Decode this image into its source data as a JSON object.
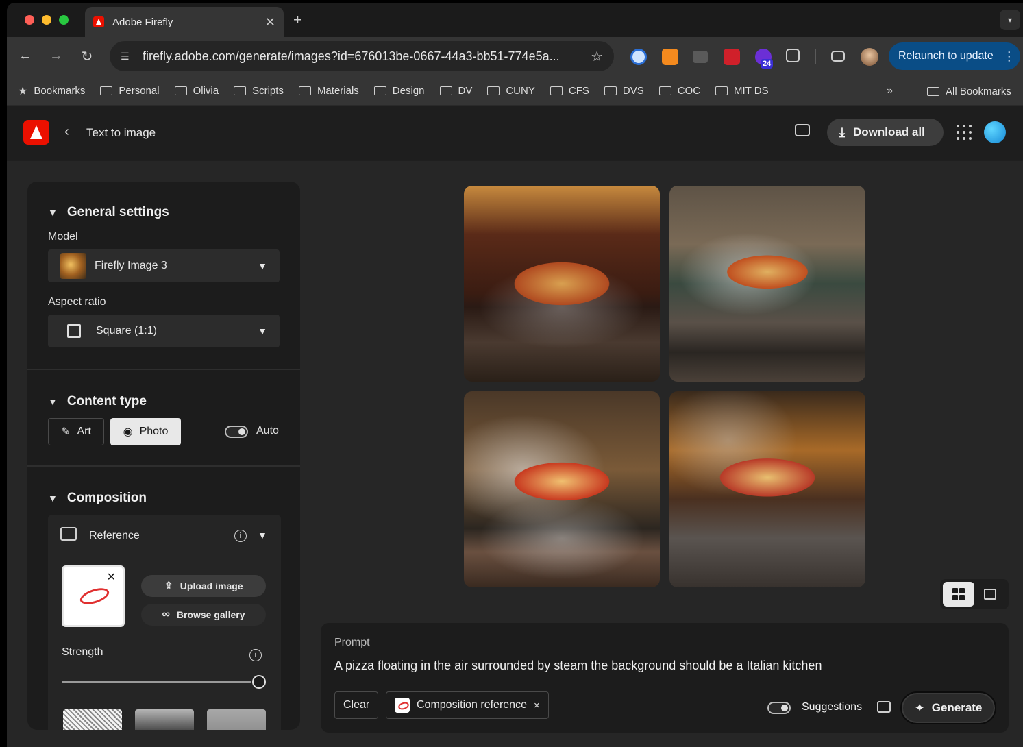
{
  "browser": {
    "tab_title": "Adobe Firefly",
    "tab_close": "✕",
    "new_tab": "+",
    "url": "firefly.adobe.com/generate/images?id=676013be-0667-44a3-bb51-774e5a...",
    "relaunch_label": "Relaunch to update",
    "extension_badge": "24",
    "bookmarks": {
      "bookmarks_label": "Bookmarks",
      "folders": [
        "Personal",
        "Olivia",
        "Scripts",
        "Materials",
        "Design",
        "DV",
        "CUNY",
        "CFS",
        "DVS",
        "COC",
        "MIT DS"
      ],
      "more": "»",
      "all_bookmarks": "All Bookmarks"
    }
  },
  "header": {
    "back_label": "Text to image",
    "download_all": "Download all"
  },
  "panel": {
    "general": {
      "title": "General settings",
      "model_label": "Model",
      "model_value": "Firefly Image 3",
      "aspect_label": "Aspect ratio",
      "aspect_value": "Square (1:1)"
    },
    "content_type": {
      "title": "Content type",
      "art": "Art",
      "photo": "Photo",
      "selected": "Photo",
      "auto": "Auto",
      "auto_on": false
    },
    "composition": {
      "title": "Composition",
      "reference_label": "Reference",
      "upload": "Upload image",
      "browse": "Browse gallery",
      "strength_label": "Strength",
      "strength": 1.0
    }
  },
  "results": {
    "count": 4,
    "view": "grid"
  },
  "prompt": {
    "label": "Prompt",
    "text": "A pizza floating in the air surrounded by steam the background should be a Italian kitchen",
    "clear": "Clear",
    "chip_label": "Composition reference",
    "chip_remove": "×",
    "suggestions": "Suggestions",
    "suggestions_on": false,
    "generate": "Generate"
  },
  "colors": {
    "adobe_red": "#eb1000",
    "relaunch_blue": "#0a4d86",
    "panel_bg": "#1c1c1c",
    "main_bg": "#262626"
  }
}
